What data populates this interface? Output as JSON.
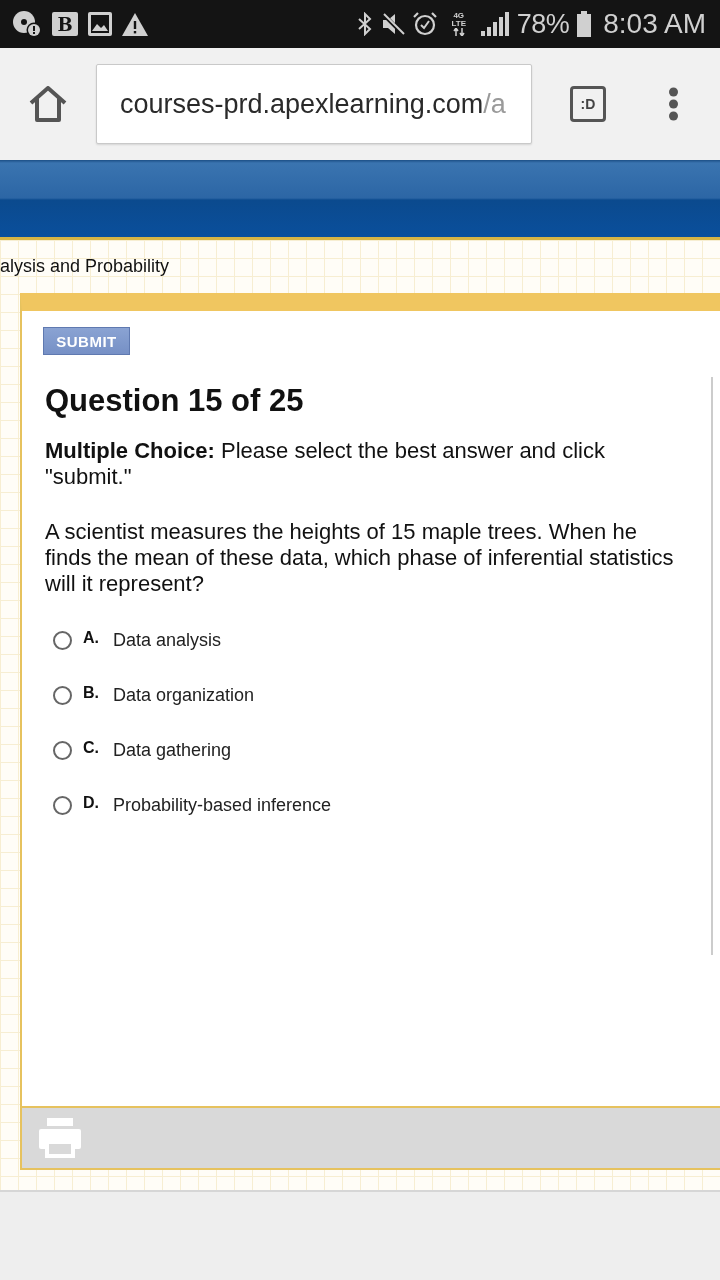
{
  "status_bar": {
    "app_letter": "B",
    "network": {
      "generation": "4G",
      "type": "LTE"
    },
    "battery": "78%",
    "time": "8:03 AM"
  },
  "browser": {
    "url": {
      "host": "courses-prd.apexlearning.com",
      "path": "/a"
    },
    "tab_button": ":D"
  },
  "breadcrumb": "alysis and Probability",
  "quiz": {
    "submit": "SUBMIT",
    "title": "Question 15 of 25",
    "instruction": "**Multiple Choice:** Please select the best answer and click \"submit.\"",
    "question": "A scientist measures the heights of 15 maple trees. When he finds the mean of these data, which phase of inferential statistics will it represent?",
    "options": [
      {
        "letter": "A.",
        "text": "Data analysis",
        "selected": false
      },
      {
        "letter": "B.",
        "text": "Data organization",
        "selected": false
      },
      {
        "letter": "C.",
        "text": "Data gathering",
        "selected": false
      },
      {
        "letter": "D.",
        "text": "Probability-based inference",
        "selected": false
      }
    ]
  }
}
